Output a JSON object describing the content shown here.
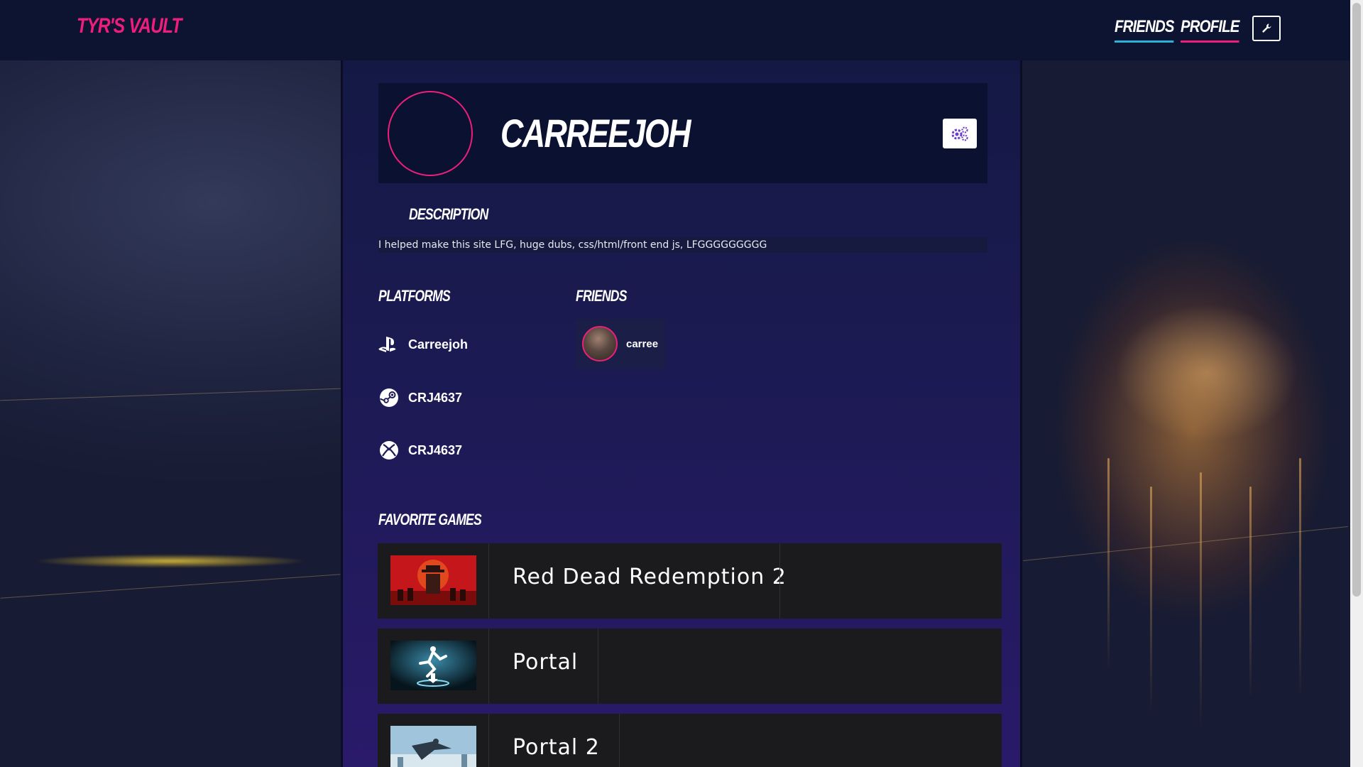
{
  "nav": {
    "brand": "TYR'S VAULT",
    "links": [
      "FRIENDS",
      "PROFILE"
    ],
    "tool_icon": "wrench-icon"
  },
  "profile": {
    "username": "CARREEJOH",
    "settings_icon": "gears-icon"
  },
  "description": {
    "title": "DESCRIPTION",
    "text": "I helped make this site LFG, huge dubs, css/html/front end js, LFGGGGGGGGG"
  },
  "platforms": {
    "title": "PLATFORMS",
    "items": [
      {
        "icon": "playstation-icon",
        "handle": "Carreejoh"
      },
      {
        "icon": "steam-icon",
        "handle": "CRJ4637"
      },
      {
        "icon": "xbox-icon",
        "handle": "CRJ4637"
      }
    ]
  },
  "friends": {
    "title": "FRIENDS",
    "items": [
      {
        "name": "carree"
      }
    ]
  },
  "favorite_games": {
    "title": "FAVORITE GAMES",
    "items": [
      {
        "title": "Red Dead Redemption 2"
      },
      {
        "title": "Portal"
      },
      {
        "title": "Portal 2"
      }
    ]
  },
  "colors": {
    "accent_pink": "#ee1e7a",
    "accent_cyan": "#2ab3d8",
    "nav_bg": "#0c1432",
    "card_bg": "#0b1130",
    "game_row_bg": "#1b1b1e",
    "settings_icon": "#6a3dd0"
  }
}
